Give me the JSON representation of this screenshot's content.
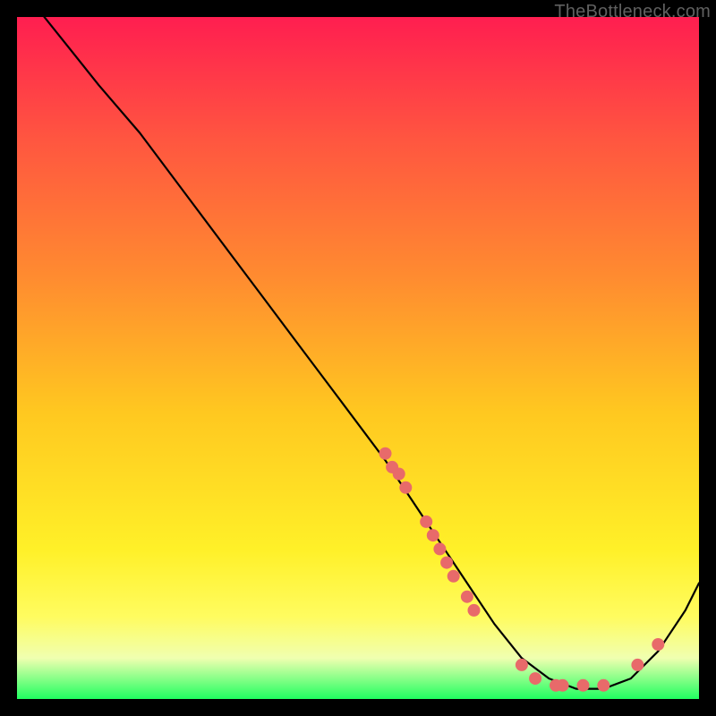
{
  "watermark": "TheBottleneck.com",
  "colors": {
    "dot": "#e86a6a",
    "curve": "#000000",
    "frame_bg_top": "#ff1e50",
    "frame_bg_bottom": "#20ff60",
    "page_bg": "#000000"
  },
  "chart_data": {
    "type": "line",
    "title": "",
    "xlabel": "",
    "ylabel": "",
    "xlim": [
      0,
      100
    ],
    "ylim": [
      0,
      100
    ],
    "grid": false,
    "legend": false,
    "series": [
      {
        "name": "curve",
        "x": [
          4,
          8,
          12,
          18,
          24,
          30,
          36,
          42,
          48,
          54,
          58,
          62,
          66,
          70,
          74,
          78,
          82,
          86,
          90,
          94,
          98,
          100
        ],
        "y": [
          100,
          95,
          90,
          83,
          75,
          67,
          59,
          51,
          43,
          35,
          29,
          23,
          17,
          11,
          6,
          3,
          1.5,
          1.5,
          3,
          7,
          13,
          17
        ]
      }
    ],
    "points": [
      {
        "name": "cluster-upper-a",
        "x": 54,
        "y": 36
      },
      {
        "name": "cluster-upper-b",
        "x": 55,
        "y": 34
      },
      {
        "name": "cluster-upper-c",
        "x": 56,
        "y": 33
      },
      {
        "name": "cluster-upper-d",
        "x": 57,
        "y": 31
      },
      {
        "name": "cluster-mid-a",
        "x": 60,
        "y": 26
      },
      {
        "name": "cluster-mid-b",
        "x": 61,
        "y": 24
      },
      {
        "name": "cluster-mid-c",
        "x": 62,
        "y": 22
      },
      {
        "name": "cluster-mid-d",
        "x": 63,
        "y": 20
      },
      {
        "name": "cluster-mid-e",
        "x": 64,
        "y": 18
      },
      {
        "name": "cluster-low-a",
        "x": 66,
        "y": 15
      },
      {
        "name": "cluster-low-b",
        "x": 67,
        "y": 13
      },
      {
        "name": "trough-a",
        "x": 74,
        "y": 5
      },
      {
        "name": "trough-b",
        "x": 76,
        "y": 3
      },
      {
        "name": "trough-c",
        "x": 79,
        "y": 2
      },
      {
        "name": "trough-d",
        "x": 80,
        "y": 2
      },
      {
        "name": "trough-e",
        "x": 83,
        "y": 2
      },
      {
        "name": "trough-f",
        "x": 86,
        "y": 2
      },
      {
        "name": "rise-a",
        "x": 91,
        "y": 5
      },
      {
        "name": "rise-b",
        "x": 94,
        "y": 8
      }
    ],
    "dot_radius": 7
  }
}
